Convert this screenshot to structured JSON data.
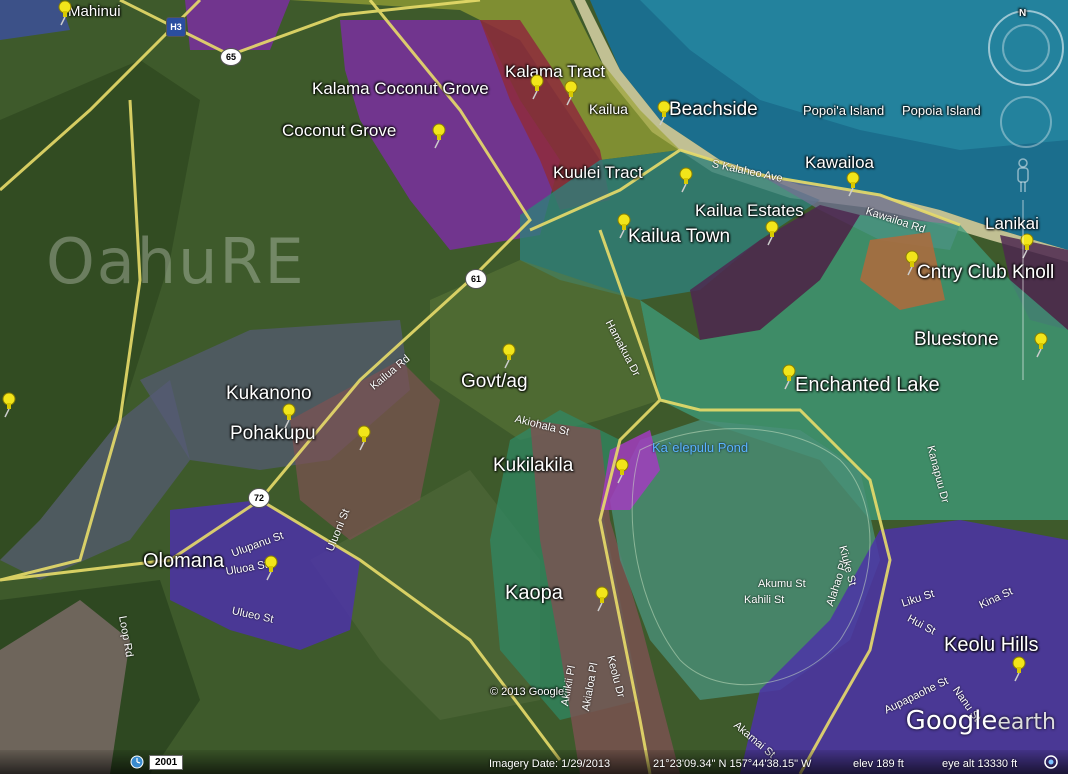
{
  "map": {
    "watermark": "OahuRE",
    "colors": {
      "purple": "#7a2fa0",
      "crimson": "#8e2a3c",
      "lime": "#9ba436",
      "teal": "#2f7f7a",
      "dark_plum": "#4d2850",
      "slate": "#555a76",
      "mint": "#3f9e7c",
      "rose_brown": "#7d5152",
      "violet_blue": "#4c33a8",
      "orange": "#b06a3c",
      "magenta": "#a23cc0",
      "ocean": "#1b6e8d",
      "land": "#3e5a2b"
    },
    "regions": [
      {
        "label": "Mahinui",
        "size": "sm"
      },
      {
        "label": "Kalama Tract",
        "size": "mid"
      },
      {
        "label": "Kalama Coconut Grove",
        "size": "mid"
      },
      {
        "label": "Beachside",
        "size": "mid"
      },
      {
        "label": "Coconut Grove",
        "size": "mid"
      },
      {
        "label": "Kuulei Tract",
        "size": "mid"
      },
      {
        "label": "Kawailoa",
        "size": "mid"
      },
      {
        "label": "Kailua Estates",
        "size": "mid"
      },
      {
        "label": "Kailua Town",
        "size": "mid"
      },
      {
        "label": "Lanikai",
        "size": "mid"
      },
      {
        "label": "Cntry Club Knoll",
        "size": "mid"
      },
      {
        "label": "Bluestone",
        "size": "mid"
      },
      {
        "label": "Govt/ag",
        "size": "mid"
      },
      {
        "label": "Enchanted Lake",
        "size": "big"
      },
      {
        "label": "Kukanono",
        "size": "mid"
      },
      {
        "label": "Pohakupu",
        "size": "mid"
      },
      {
        "label": "Kukilakila",
        "size": "mid"
      },
      {
        "label": "Olomana",
        "size": "big"
      },
      {
        "label": "Kaopa",
        "size": "big"
      },
      {
        "label": "Keolu Hills",
        "size": "big"
      }
    ],
    "places": {
      "kailua": "Kailua",
      "popoia_island_1": "Popoi'a Island",
      "popoia_island_2": "Popoia Island",
      "pond": "Ka`elepulu Pond"
    },
    "streets": [
      "S Kalaheo Ave",
      "Kawailoa Rd",
      "Hamakua Dr",
      "Kailua Rd",
      "Akiohala St",
      "Ulupanu St",
      "Uluoa St",
      "Ulueo St",
      "Uluoni St",
      "Loop Rd",
      "Akumu St",
      "Kahili St",
      "Alahao Pl",
      "Kiuke St",
      "Kanapuu Dr",
      "Liku St",
      "Hui St",
      "Kina St",
      "Aupapaohe St",
      "Nanu St",
      "Akamai St",
      "Akiikii Pl",
      "Akialoa Pl",
      "Keolu Dr"
    ],
    "highways": {
      "h3": "H3",
      "r65": "65",
      "r61": "61",
      "r72": "72"
    },
    "copyright": "© 2013 Google",
    "logo_brand": "Google",
    "logo_suffix": "earth",
    "compass": "N"
  },
  "status": {
    "year": "2001",
    "imagery_date": "Imagery Date: 1/29/2013",
    "coordinates": "21°23'09.34\" N  157°44'38.15\" W",
    "elev": "elev   189 ft",
    "eye_alt": "eye alt  13330 ft"
  }
}
